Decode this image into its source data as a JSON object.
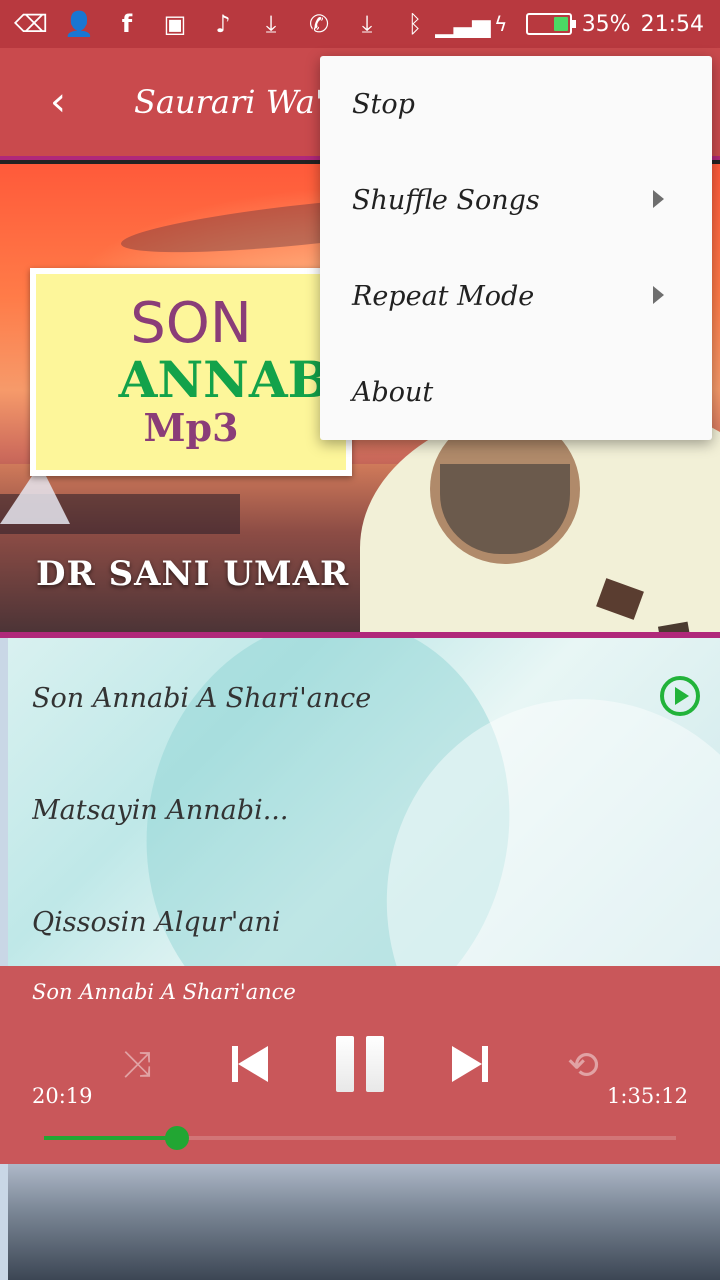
{
  "status_bar": {
    "icons": [
      "back-key-icon",
      "add-contact-icon",
      "facebook-icon",
      "image-icon",
      "music-note-icon",
      "download-icon",
      "whatsapp-icon",
      "download-icon",
      "bluetooth-icon",
      "signal-icon",
      "charging-icon"
    ],
    "battery_percent_label": "35%",
    "battery_level": 0.35,
    "time": "21:54"
  },
  "app_bar": {
    "title": "Saurari Wa'"
  },
  "banner": {
    "card_title": "SON",
    "card_subtitle": "ANNABI",
    "card_format": "Mp3",
    "author": "DR SANI UMAR"
  },
  "song_list": {
    "items": [
      {
        "title": "Son Annabi A Shari'ance"
      },
      {
        "title": "Matsayin Annabi..."
      },
      {
        "title": "Qissosin Alqur'ani"
      }
    ]
  },
  "player": {
    "now_playing": "Son Annabi A Shari'ance",
    "current_time": "20:19",
    "total_time": "1:35:12",
    "progress_fraction": 0.21
  },
  "menu": {
    "items": [
      {
        "label": "Stop",
        "has_submenu": false
      },
      {
        "label": "Shuffle Songs",
        "has_submenu": true
      },
      {
        "label": "Repeat Mode",
        "has_submenu": true
      },
      {
        "label": "About",
        "has_submenu": false
      }
    ]
  },
  "colors": {
    "status_bar": "#b8393f",
    "app_bar": "#c94a4d",
    "accent_border": "#b0287a",
    "player_bg": "#c9575a",
    "progress": "#22a633",
    "playing_indicator": "#22b33a"
  }
}
